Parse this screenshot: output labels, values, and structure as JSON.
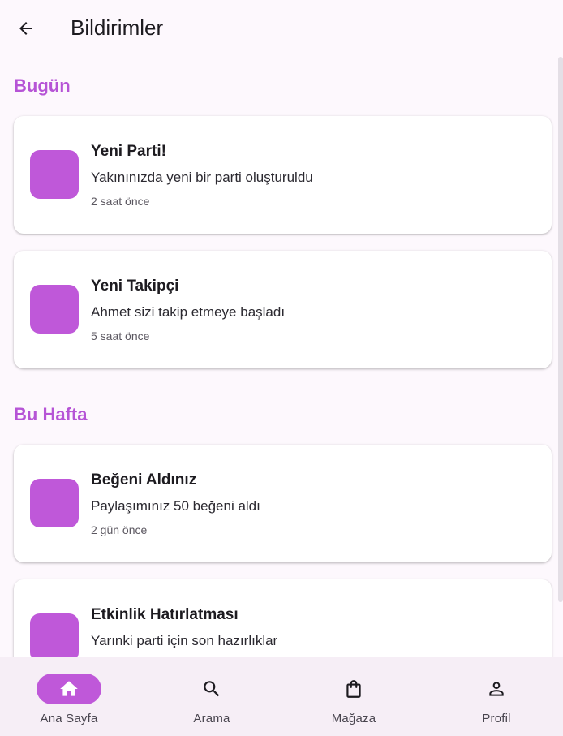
{
  "app_bar": {
    "title": "Bildirimler",
    "back_icon": "arrow-back-icon"
  },
  "sections": [
    {
      "header": "Bugün",
      "notifications": [
        {
          "title": "Yeni Parti!",
          "body": "Yakınınızda yeni bir parti oluşturuldu",
          "time": "2 saat önce",
          "icon_color": "#bf58d9"
        },
        {
          "title": "Yeni Takipçi",
          "body": "Ahmet sizi takip etmeye başladı",
          "time": "5 saat önce",
          "icon_color": "#bf58d9"
        }
      ]
    },
    {
      "header": "Bu Hafta",
      "notifications": [
        {
          "title": "Beğeni Aldınız",
          "body": "Paylaşımınız 50 beğeni aldı",
          "time": "2 gün önce",
          "icon_color": "#bf58d9"
        },
        {
          "title": "Etkinlik Hatırlatması",
          "body": "Yarınki parti için son hazırlıklar",
          "time": "",
          "icon_color": "#bf58d9"
        }
      ]
    }
  ],
  "bottom_nav": {
    "items": [
      {
        "label": "Ana Sayfa",
        "icon": "home-icon",
        "active": true
      },
      {
        "label": "Arama",
        "icon": "search-icon",
        "active": false
      },
      {
        "label": "Mağaza",
        "icon": "shopping-bag-icon",
        "active": false
      },
      {
        "label": "Profil",
        "icon": "person-icon",
        "active": false
      }
    ]
  },
  "colors": {
    "accent": "#bf58d9",
    "section_header": "#b654d6",
    "background": "#fdf8fd",
    "nav_background": "#f6eef6"
  }
}
